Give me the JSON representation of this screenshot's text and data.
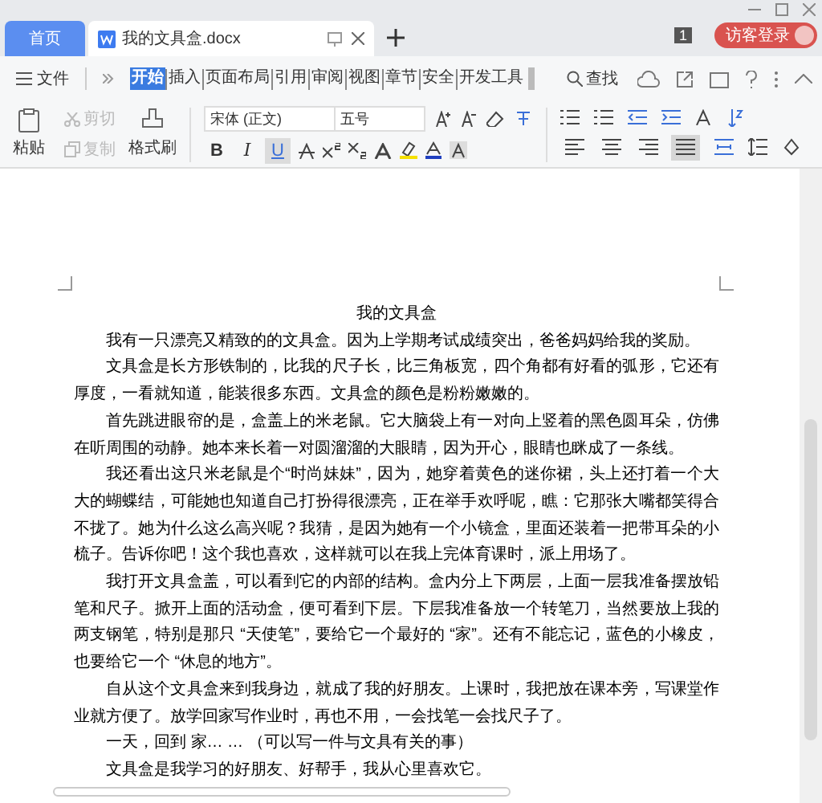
{
  "title_bar": {
    "tabs": [
      {
        "label": "首页",
        "kind": "home",
        "selected": false
      },
      {
        "label": "我的文具盒.docx",
        "kind": "document",
        "selected": true
      }
    ],
    "badge": "1",
    "login_button": "访客登录"
  },
  "menu": {
    "file": "文件",
    "tabs": [
      {
        "label": "开始",
        "selected": true
      },
      {
        "label": "插入",
        "selected": false
      },
      {
        "label": "页面布局",
        "selected": false
      },
      {
        "label": "引用",
        "selected": false
      },
      {
        "label": "审阅",
        "selected": false
      },
      {
        "label": "视图",
        "selected": false
      },
      {
        "label": "章节",
        "selected": false
      },
      {
        "label": "安全",
        "selected": false
      },
      {
        "label": "开发工具",
        "selected": false
      }
    ],
    "search": "查找"
  },
  "toolbar": {
    "paste": "粘贴",
    "clip_items": [
      {
        "label": "剪切",
        "disabled": true
      },
      {
        "label": "复制",
        "disabled": true
      }
    ],
    "format_painter": "格式刷",
    "font": "宋体 (正文)",
    "size": "五号",
    "format_buttons": [
      {
        "label": "B",
        "selected": false
      },
      {
        "label": "I",
        "selected": false
      },
      {
        "label": "U",
        "selected": true
      }
    ],
    "align_buttons": [
      {
        "selected": false
      },
      {
        "selected": false
      },
      {
        "selected": false
      },
      {
        "selected": true
      }
    ]
  },
  "document": {
    "title": "我的文具盒",
    "paragraphs": [
      "我有一只漂亮又精致的的文具盒。因为上学期考试成绩突出，爸爸妈妈给我的奖励。",
      "文具盒是长方形铁制的，比我的尺子长，比三角板宽，四个角都有好看的弧形，它还有厚度，一看就知道，能装很多东西。文具盒的颜色是粉粉嫩嫩的。",
      "首先跳进眼帘的是，盒盖上的米老鼠。它大脑袋上有一对向上竖着的黑色圆耳朵，仿佛在听周围的动静。她本来长着一对圆溜溜的大眼睛，因为开心，眼睛也眯成了一条线。",
      "我还看出这只米老鼠是个“时尚妹妹”，因为，她穿着黄色的迷你裙，头上还打着一个大大的蝴蝶结，可能她也知道自己打扮得很漂亮，正在举手欢呼呢，瞧：它那张大嘴都笑得合不拢了。她为什么这么高兴呢？我猜，是因为她有一个小镜盒，里面还装着一把带耳朵的小梳子。告诉你吧！这个我也喜欢，这样就可以在我上完体育课时，派上用场了。",
      "我打开文具盒盖，可以看到它的内部的结构。盒内分上下两层，上面一层我准备摆放铅笔和尺子。掀开上面的活动盒，便可看到下层。下层我准备放一个转笔刀，当然要放上我的两支钢笔，特别是那只 “天使笔”，要给它一个最好的 “家”。还有不能忘记，蓝色的小橡皮，也要给它一个 “休息的地方”。",
      "自从这个文具盒来到我身边，就成了我的好朋友。上课时，我把放在课本旁，写课堂作业就方便了。放学回家写作业时，再也不用，一会找笔一会找尺子了。",
      "一天，回到 家… …  （可以写一件与文具有关的事）",
      "文具盒是我学习的好朋友、好帮手，我从心里喜欢它。"
    ]
  }
}
